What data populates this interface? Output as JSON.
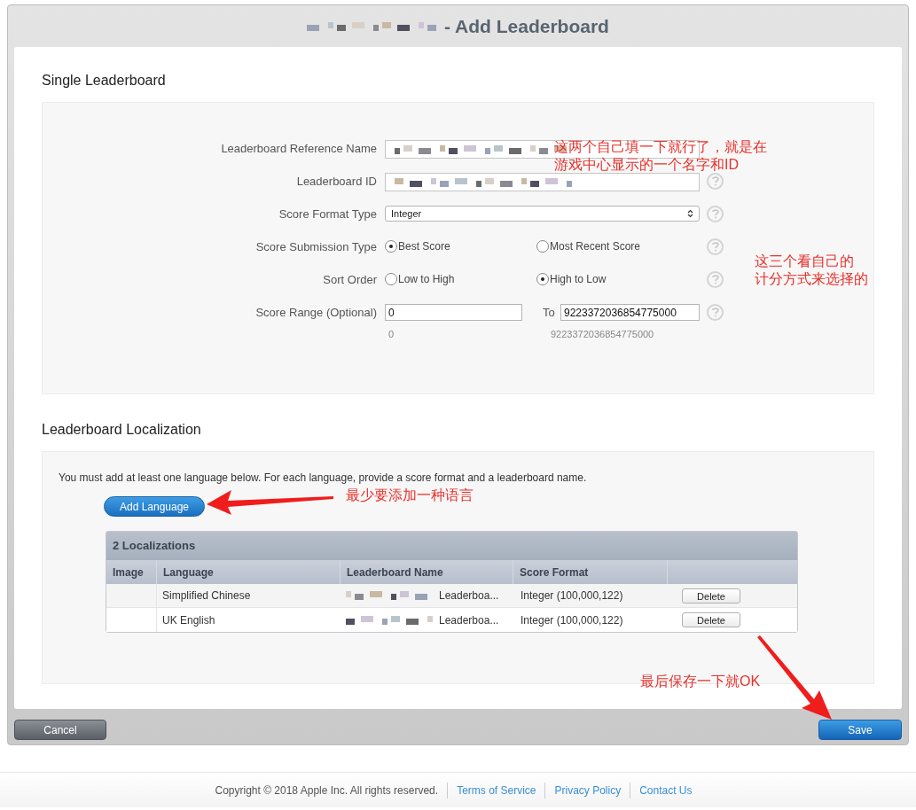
{
  "window": {
    "title": "- Add Leaderboard"
  },
  "single_leaderboard": {
    "heading": "Single Leaderboard",
    "fields": [
      {
        "kind": "text",
        "label": "Leaderboard Reference Name",
        "redacted": true,
        "help": false
      },
      {
        "kind": "text",
        "label": "Leaderboard ID",
        "redacted": true,
        "help": true
      },
      {
        "kind": "select",
        "label": "Score Format Type",
        "value": "Integer",
        "help": true
      },
      {
        "kind": "radio",
        "label": "Score Submission Type",
        "help": true,
        "options": [
          {
            "label": "Best Score",
            "selected": true
          },
          {
            "label": "Most Recent Score",
            "selected": false
          }
        ]
      },
      {
        "kind": "radio",
        "label": "Sort Order",
        "help": true,
        "options": [
          {
            "label": "Low to High",
            "selected": false
          },
          {
            "label": "High to Low",
            "selected": true
          }
        ]
      },
      {
        "kind": "range",
        "label": "Score Range (Optional)",
        "help": true,
        "from": "0",
        "to_label": "To",
        "to": "9223372036854775000",
        "from_hint": "0",
        "to_hint": "9223372036854775000"
      }
    ]
  },
  "localization": {
    "heading": "Leaderboard Localization",
    "intro": "You must add at least one language below. For each language, provide a score format and a leaderboard name.",
    "add_button": "Add Language",
    "table": {
      "title": "2 Localizations",
      "columns": [
        "Image",
        "Language",
        "Leaderboard Name",
        "Score Format",
        ""
      ],
      "rows": [
        {
          "language": "Simplified Chinese",
          "name": "Leaderboa...",
          "score_format": "Integer (100,000,122)",
          "action": "Delete"
        },
        {
          "language": "UK English",
          "name": "Leaderboa...",
          "score_format": "Integer (100,000,122)",
          "action": "Delete"
        }
      ]
    }
  },
  "buttons": {
    "cancel": "Cancel",
    "save": "Save"
  },
  "footer": {
    "copyright": "Copyright © 2018 Apple Inc. All rights reserved.",
    "links": [
      "Terms of Service",
      "Privacy Policy",
      "Contact Us"
    ]
  },
  "annotations": [
    {
      "lines": [
        "这两个自己填一下就行了，就是在",
        "游戏中心显示的一个名字和ID"
      ]
    },
    {
      "lines": [
        "这三个看自己的",
        "计分方式来选择的"
      ]
    },
    {
      "lines": [
        "最少要添加一种语言"
      ]
    },
    {
      "lines": [
        "最后保存一下就OK"
      ]
    }
  ]
}
